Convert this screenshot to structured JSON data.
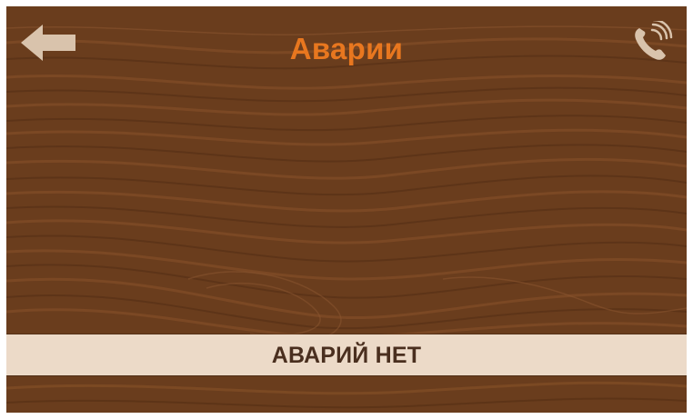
{
  "header": {
    "title": "Аварии",
    "back_icon": "arrow-left-icon",
    "call_icon": "phone-call-icon"
  },
  "status": {
    "message": "АВАРИЙ НЕТ"
  },
  "colors": {
    "background_wood": "#6a3d1d",
    "title": "#e8771f",
    "status_bar": "#ecdac8",
    "status_text": "#4a2f1f",
    "icon": "#d9c3ac"
  }
}
